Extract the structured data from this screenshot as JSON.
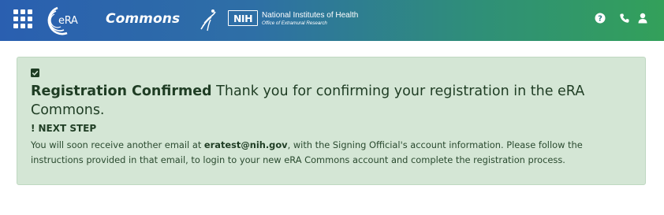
{
  "header": {
    "app_logo_text": "eRA",
    "app_name": "Commons",
    "nih_abbr": "NIH",
    "nih_name": "National Institutes of Health",
    "nih_office": "Office of Extramural Research",
    "icons": [
      "apps-grid-icon",
      "help-icon",
      "phone-icon",
      "user-icon"
    ],
    "gradient_colors": [
      "#2a5fb0",
      "#33a05a"
    ]
  },
  "alert": {
    "title_strong": "Registration Confirmed",
    "title_rest": " Thank you for confirming your registration in the eRA Commons.",
    "next_step_bang": "!",
    "next_step_label": "NEXT STEP",
    "body_before_email": "You will soon receive another email at ",
    "email": "eratest@nih.gov",
    "body_after_email": ", with the Signing Official's account information. Please follow the instructions provided in that email, to login to your new eRA Commons account and complete the registration process.",
    "background_color": "#d4e6d5",
    "icon": "check-square-icon"
  }
}
